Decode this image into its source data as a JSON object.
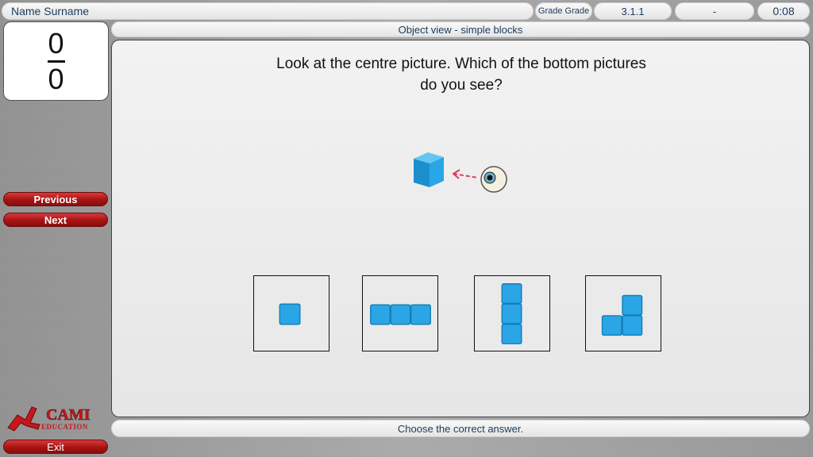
{
  "header": {
    "student_name": "Name Surname",
    "grade": "Grade Grade",
    "level": "3.1.1",
    "attempt": "-",
    "timer": "0:08"
  },
  "score": {
    "correct": "0",
    "total": "0"
  },
  "section_title": "Object view - simple blocks",
  "question": {
    "line1": "Look at the centre picture. Which of the bottom pictures",
    "line2": "do you see?"
  },
  "nav": {
    "previous": "Previous",
    "next": "Next",
    "exit": "Exit"
  },
  "logo": {
    "line1": "CAMI",
    "line2": "EDUCATION"
  },
  "footer_instruction": "Choose the correct answer.",
  "options": [
    {
      "id": 1,
      "icon": "single-block"
    },
    {
      "id": 2,
      "icon": "three-blocks-horizontal"
    },
    {
      "id": 3,
      "icon": "three-blocks-vertical"
    },
    {
      "id": 4,
      "icon": "l-shape-blocks"
    }
  ],
  "colors": {
    "block": "#2aa6e6",
    "button": "#b01c1c",
    "arrow": "#e23a5a"
  }
}
